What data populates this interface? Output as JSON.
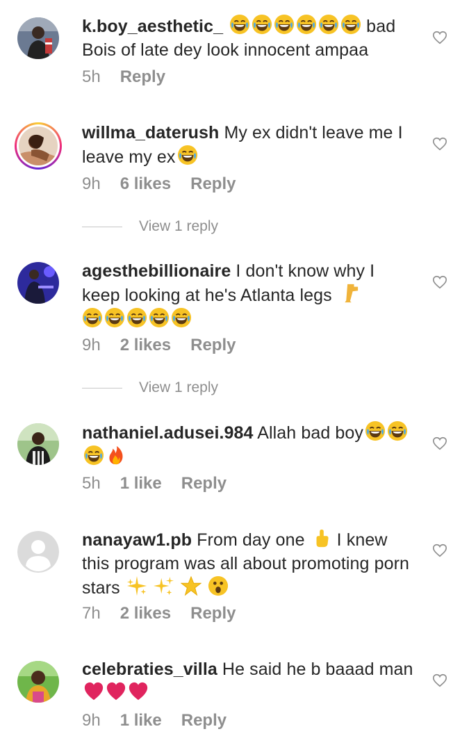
{
  "comments": [
    {
      "username": "k.boy_aesthetic_",
      "body_a": " ",
      "body_b": " bad Bois of late dey look innocent ampaa",
      "time": "5h",
      "likes": "",
      "reply": "Reply",
      "avatar_icon": "profile-photo",
      "emojis": [
        "laughing-emoji",
        "laughing-emoji",
        "laughing-emoji",
        "laughing-emoji",
        "laughing-emoji",
        "laughing-emoji"
      ]
    },
    {
      "username": "willma_daterush",
      "body_a": " My ex didn't leave me I leave my ex",
      "body_b": "",
      "time": "9h",
      "likes": "6 likes",
      "reply": "Reply",
      "view_replies": "View 1 reply"
    },
    {
      "username": "agesthebillionaire",
      "body_a": " I don't know why I keep looking at he's Atlanta legs ",
      "body_b": "",
      "time": "9h",
      "likes": "2 likes",
      "reply": "Reply",
      "view_replies": "View 1 reply"
    },
    {
      "username": "nathaniel.adusei.984",
      "body_a": " Allah bad boy",
      "body_b": "",
      "time": "5h",
      "likes": "1 like",
      "reply": "Reply"
    },
    {
      "username": "nanayaw1.pb",
      "body_a": " From day one ",
      "body_b": " I knew this program was all about promoting porn stars ",
      "time": "7h",
      "likes": "2 likes",
      "reply": "Reply"
    },
    {
      "username": "celebraties_villa",
      "body_a": " He said he b baaad man",
      "body_b": "",
      "time": "9h",
      "likes": "1 like",
      "reply": "Reply"
    }
  ],
  "colors": {
    "text": "#262626",
    "meta": "#8e8e8e",
    "laugh_face": "#f7c325",
    "heart_red": "#e0245e"
  }
}
